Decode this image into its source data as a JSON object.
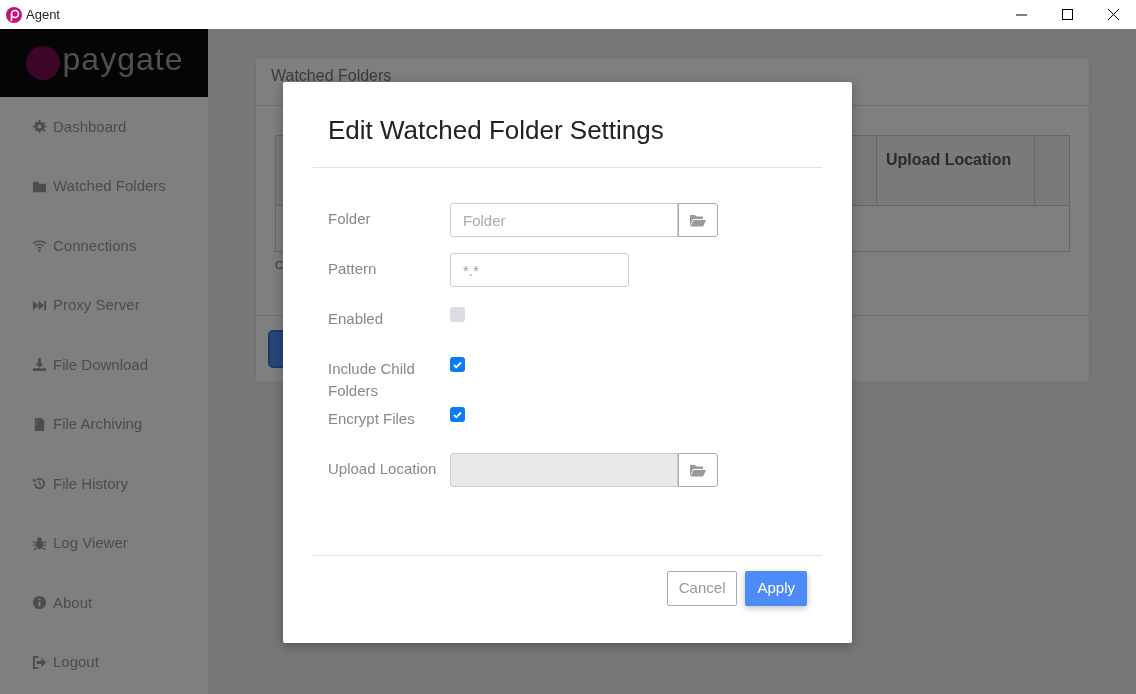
{
  "window": {
    "title": "Agent"
  },
  "sidebar": {
    "logo": "paygate",
    "items": [
      {
        "label": "Dashboard"
      },
      {
        "label": "Watched Folders"
      },
      {
        "label": "Connections"
      },
      {
        "label": "Proxy Server"
      },
      {
        "label": "File Download"
      },
      {
        "label": "File Archiving"
      },
      {
        "label": "File History"
      },
      {
        "label": "Log Viewer"
      },
      {
        "label": "About"
      },
      {
        "label": "Logout"
      }
    ]
  },
  "background_card": {
    "title": "Watched Folders",
    "table": {
      "columns": [
        "Upload Location"
      ]
    },
    "note": "C"
  },
  "modal": {
    "title": "Edit Watched Folder Settings",
    "fields": [
      {
        "kind": "browse",
        "label": "Folder",
        "placeholder": "Folder",
        "disabled": false
      },
      {
        "kind": "text",
        "label": "Pattern",
        "value": "*.*"
      },
      {
        "kind": "checkbox",
        "label": "Enabled",
        "checked": false,
        "disabled": true
      },
      {
        "kind": "checkbox",
        "label": "Include Child Folders",
        "checked": true,
        "disabled": false
      },
      {
        "kind": "checkbox",
        "label": "Encrypt Files",
        "checked": true,
        "disabled": false
      },
      {
        "kind": "browse",
        "label": "Upload Location",
        "disabled": true
      }
    ],
    "buttons": [
      {
        "label": "Cancel",
        "kind": "secondary"
      },
      {
        "label": "Apply",
        "kind": "primary"
      }
    ]
  }
}
